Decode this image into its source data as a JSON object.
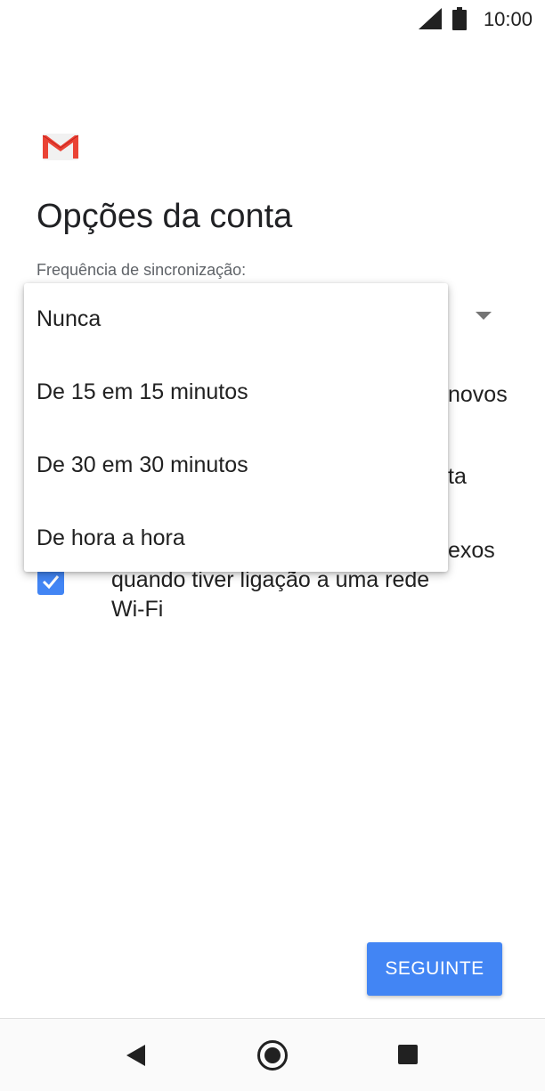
{
  "status_bar": {
    "time": "10:00",
    "signal_icon": "signal-icon",
    "battery_icon": "battery-icon"
  },
  "app": {
    "logo_icon": "gmail-logo-icon"
  },
  "page": {
    "title": "Opções da conta",
    "sync_label": "Frequência de sincronização:"
  },
  "options": {
    "notify_tail": "novos",
    "sync_tail": "ta",
    "download_line1_tail": "exos",
    "download_line2": "quando tiver ligação a uma rede",
    "download_line3": "Wi-Fi",
    "download_checked": true
  },
  "dropdown_menu": {
    "items": [
      {
        "label": "Nunca"
      },
      {
        "label": "De 15 em 15 minutos"
      },
      {
        "label": "De 30 em 30 minutos"
      },
      {
        "label": "De hora a hora"
      }
    ]
  },
  "footer": {
    "next_label": "SEGUINTE"
  },
  "nav_bar": {
    "back_icon": "back-icon",
    "home_icon": "home-icon",
    "recents_icon": "recents-icon"
  },
  "colors": {
    "accent": "#4285f4",
    "gmail_red": "#ea4335",
    "text": "#212121"
  }
}
